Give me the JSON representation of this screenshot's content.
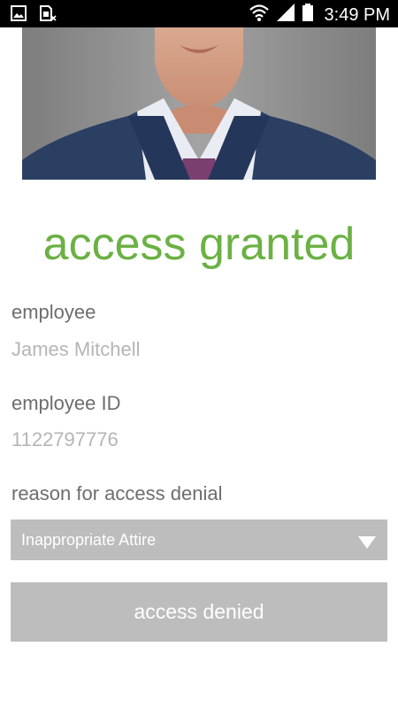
{
  "status_bar": {
    "time": "3:49 PM",
    "icons": [
      "image-icon",
      "sim-icon",
      "wifi-icon",
      "signal-icon",
      "battery-icon"
    ]
  },
  "photo": {
    "subject": "employee-photo",
    "colors": {
      "background": "#8c8c8c",
      "suit": "#2b3f63",
      "shirt": "#e9edf3",
      "tie": "#7a3f6e",
      "skin": "#d6a58a"
    }
  },
  "access": {
    "status_text": "access granted",
    "status_color": "#6bb144"
  },
  "employee": {
    "label": "employee",
    "name": "James Mitchell"
  },
  "employee_id": {
    "label": "employee ID",
    "value": "1122797776"
  },
  "reason": {
    "label": "reason for access denial",
    "selected": "Inappropriate Attire"
  },
  "actions": {
    "deny_label": "access denied"
  }
}
